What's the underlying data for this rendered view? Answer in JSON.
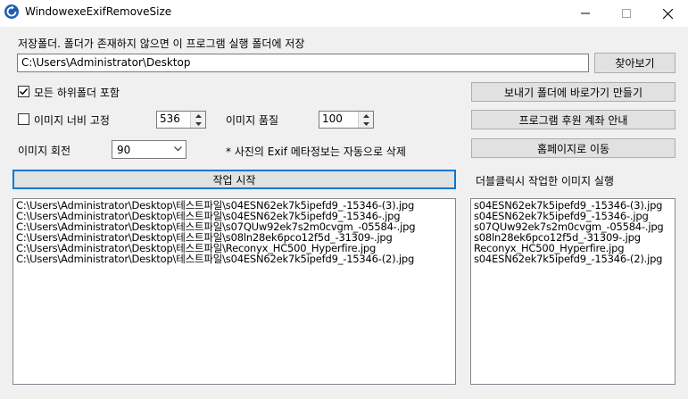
{
  "window": {
    "title": "WindowexeExifRemoveSize"
  },
  "save_folder": {
    "label": "저장폴더. 폴더가 존재하지 않으면 이 프로그램 실행 폴더에 저장",
    "path": "C:\\Users\\Administrator\\Desktop",
    "browse_label": "찾아보기"
  },
  "options": {
    "include_subfolders_label": "모든 하위폴더 포함",
    "include_subfolders_checked": true,
    "fix_width_label": "이미지 너비 고정",
    "fix_width_checked": false,
    "width_value": "536",
    "quality_label": "이미지 품질",
    "quality_value": "100",
    "rotation_label": "이미지 회전",
    "rotation_value": "90",
    "exif_note": "* 사진의 Exif 메타정보는 자동으로 삭제"
  },
  "side_buttons": {
    "shortcut_label": "보내기 폴더에 바로가기 만들기",
    "donate_label": "프로그램 후원 계좌 안내",
    "homepage_label": "홈페이지로 이동"
  },
  "start_button_label": "작업 시작",
  "right_list_label": "더블클릭시 작업한 이미지 실행",
  "source_files": [
    "C:\\Users\\Administrator\\Desktop\\테스트파일\\s04ESN62ek7k5ipefd9_-15346-(3).jpg",
    "C:\\Users\\Administrator\\Desktop\\테스트파일\\s04ESN62ek7k5ipefd9_-15346-.jpg",
    "C:\\Users\\Administrator\\Desktop\\테스트파일\\s07QUw92ek7s2m0cvgm_-05584-.jpg",
    "C:\\Users\\Administrator\\Desktop\\테스트파일\\s08ln28ek6pco12f5d_-31309-.jpg",
    "C:\\Users\\Administrator\\Desktop\\테스트파일\\Reconyx_HC500_Hyperfire.jpg",
    "C:\\Users\\Administrator\\Desktop\\테스트파일\\s04ESN62ek7k5ipefd9_-15346-(2).jpg"
  ],
  "result_files": [
    "s04ESN62ek7k5ipefd9_-15346-(3).jpg",
    "s04ESN62ek7k5ipefd9_-15346-.jpg",
    "s07QUw92ek7s2m0cvgm_-05584-.jpg",
    "s08ln28ek6pco12f5d_-31309-.jpg",
    "Reconyx_HC500_Hyperfire.jpg",
    "s04ESN62ek7k5ipefd9_-15346-(2).jpg"
  ],
  "icons": {
    "app": "refresh-circle-icon",
    "minimize": "minimize-icon",
    "maximize": "maximize-icon",
    "close": "close-icon"
  },
  "colors": {
    "accent": "#0078d7",
    "window_bg": "#f0f0f0",
    "app_icon": "#1b5fb5"
  }
}
